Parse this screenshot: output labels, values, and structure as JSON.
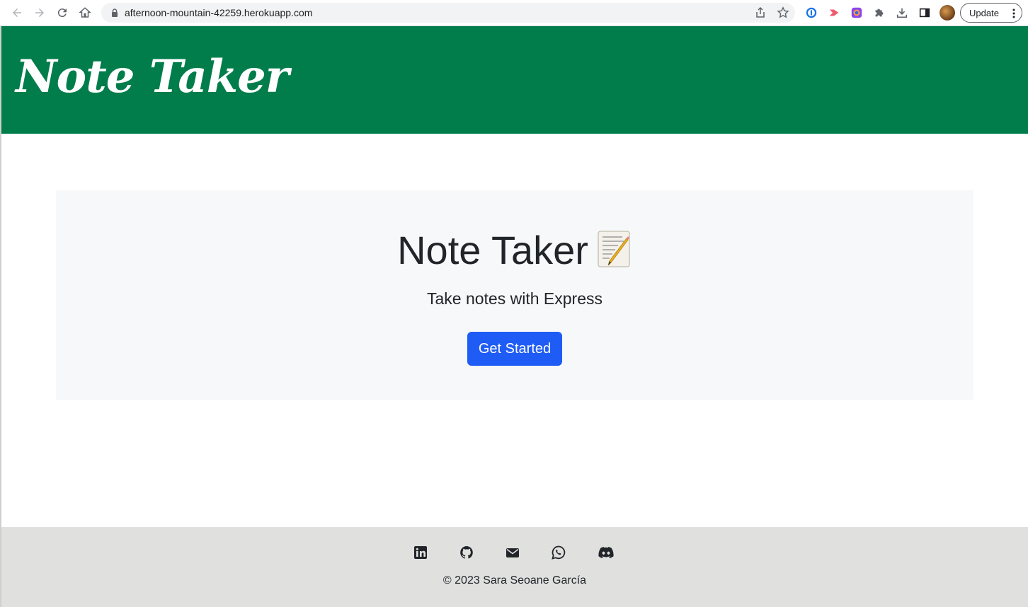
{
  "browser": {
    "url": "afternoon-mountain-42259.herokuapp.com",
    "update_label": "Update",
    "icons": [
      "back-icon",
      "forward-icon",
      "reload-icon",
      "home-icon",
      "lock-icon",
      "share-icon",
      "star-icon",
      "1password-icon",
      "extension-icon",
      "color-icon",
      "puzzle-icon",
      "download-icon",
      "sidepanel-icon",
      "avatar",
      "kebab-icon"
    ]
  },
  "header": {
    "brand": "Note Taker",
    "color": "#007d4a"
  },
  "hero": {
    "title": "Note Taker",
    "title_icon": "memo-icon",
    "subtitle": "Take notes with Express",
    "button_label": "Get Started",
    "button_color": "#1e5cf5"
  },
  "footer": {
    "social_icons": [
      "linkedin-icon",
      "github-icon",
      "email-icon",
      "whatsapp-icon",
      "discord-icon"
    ],
    "copyright": "© 2023 Sara Seoane García"
  }
}
